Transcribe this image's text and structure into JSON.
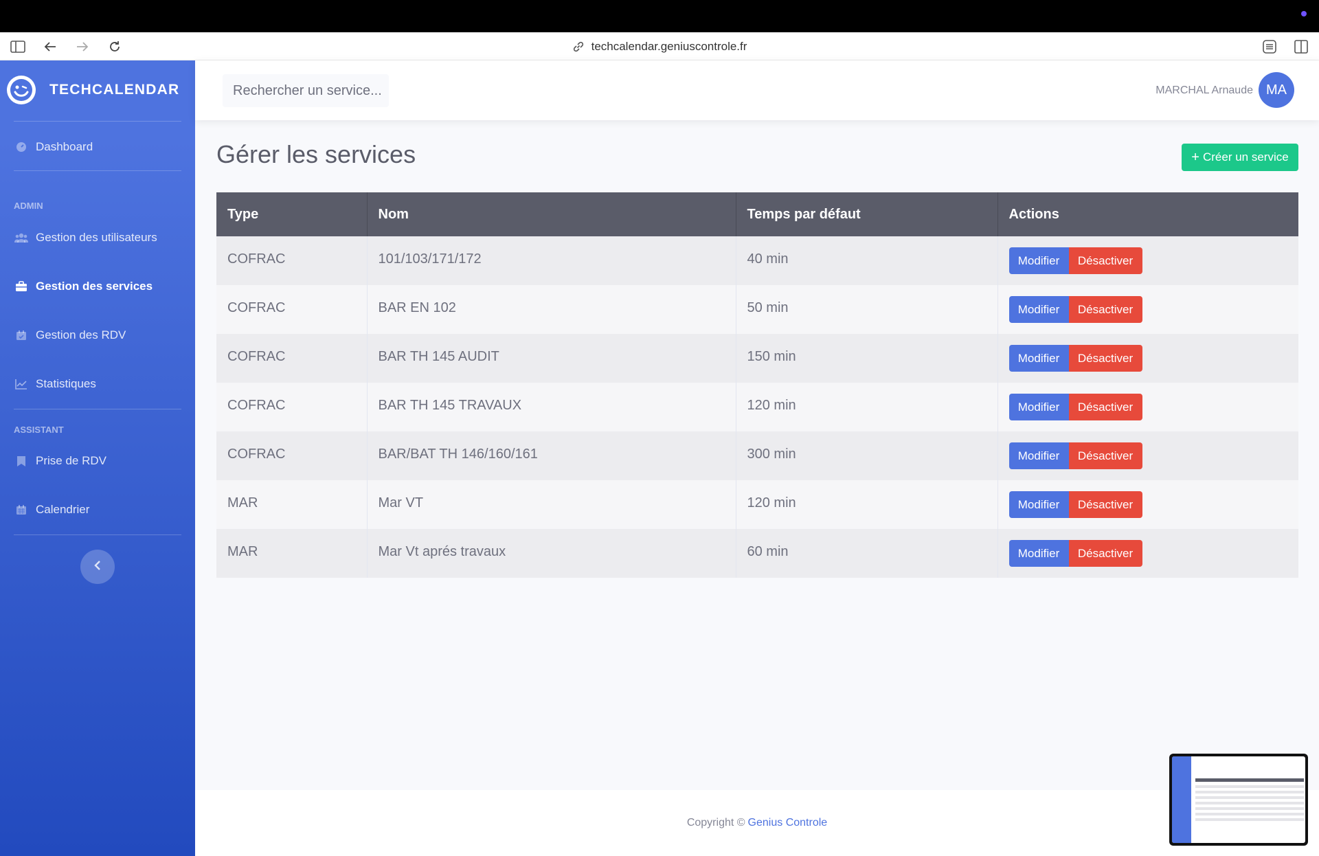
{
  "browser": {
    "url": "techcalendar.geniuscontrole.fr"
  },
  "sidebar": {
    "brand": "TECHCALENDAR",
    "dashboard": "Dashboard",
    "admin_heading": "ADMIN",
    "admin_items": [
      {
        "label": "Gestion des utilisateurs",
        "icon": "users-icon"
      },
      {
        "label": "Gestion des services",
        "icon": "briefcase-icon",
        "active": true
      },
      {
        "label": "Gestion des RDV",
        "icon": "calendar-check-icon"
      },
      {
        "label": "Statistiques",
        "icon": "chart-line-icon"
      }
    ],
    "assistant_heading": "ASSISTANT",
    "assistant_items": [
      {
        "label": "Prise de RDV",
        "icon": "bookmark-icon"
      },
      {
        "label": "Calendrier",
        "icon": "calendar-icon"
      }
    ]
  },
  "topbar": {
    "search_placeholder": "Rechercher un service...",
    "user_name": "MARCHAL Arnaude",
    "avatar_initials": "MA"
  },
  "main": {
    "title": "Gérer les services",
    "create_button": "Créer un service",
    "table": {
      "headers": [
        "Type",
        "Nom",
        "Temps par défaut",
        "Actions"
      ],
      "rows": [
        {
          "type": "COFRAC",
          "nom": "101/103/171/172",
          "temps": "40 min"
        },
        {
          "type": "COFRAC",
          "nom": "BAR EN 102",
          "temps": "50 min"
        },
        {
          "type": "COFRAC",
          "nom": "BAR TH 145 AUDIT",
          "temps": "150 min"
        },
        {
          "type": "COFRAC",
          "nom": "BAR TH 145 TRAVAUX",
          "temps": "120 min"
        },
        {
          "type": "COFRAC",
          "nom": "BAR/BAT TH 146/160/161",
          "temps": "300 min"
        },
        {
          "type": "MAR",
          "nom": "Mar VT",
          "temps": "120 min"
        },
        {
          "type": "MAR",
          "nom": "Mar Vt aprés travaux",
          "temps": "60 min"
        }
      ],
      "modify_label": "Modifier",
      "deactivate_label": "Désactiver"
    }
  },
  "footer": {
    "copyright": "Copyright ©",
    "company": "Genius Controle"
  },
  "colors": {
    "primary": "#4e73df",
    "success": "#1cc88a",
    "danger": "#e74a3b",
    "table_header": "#5a5c69"
  }
}
